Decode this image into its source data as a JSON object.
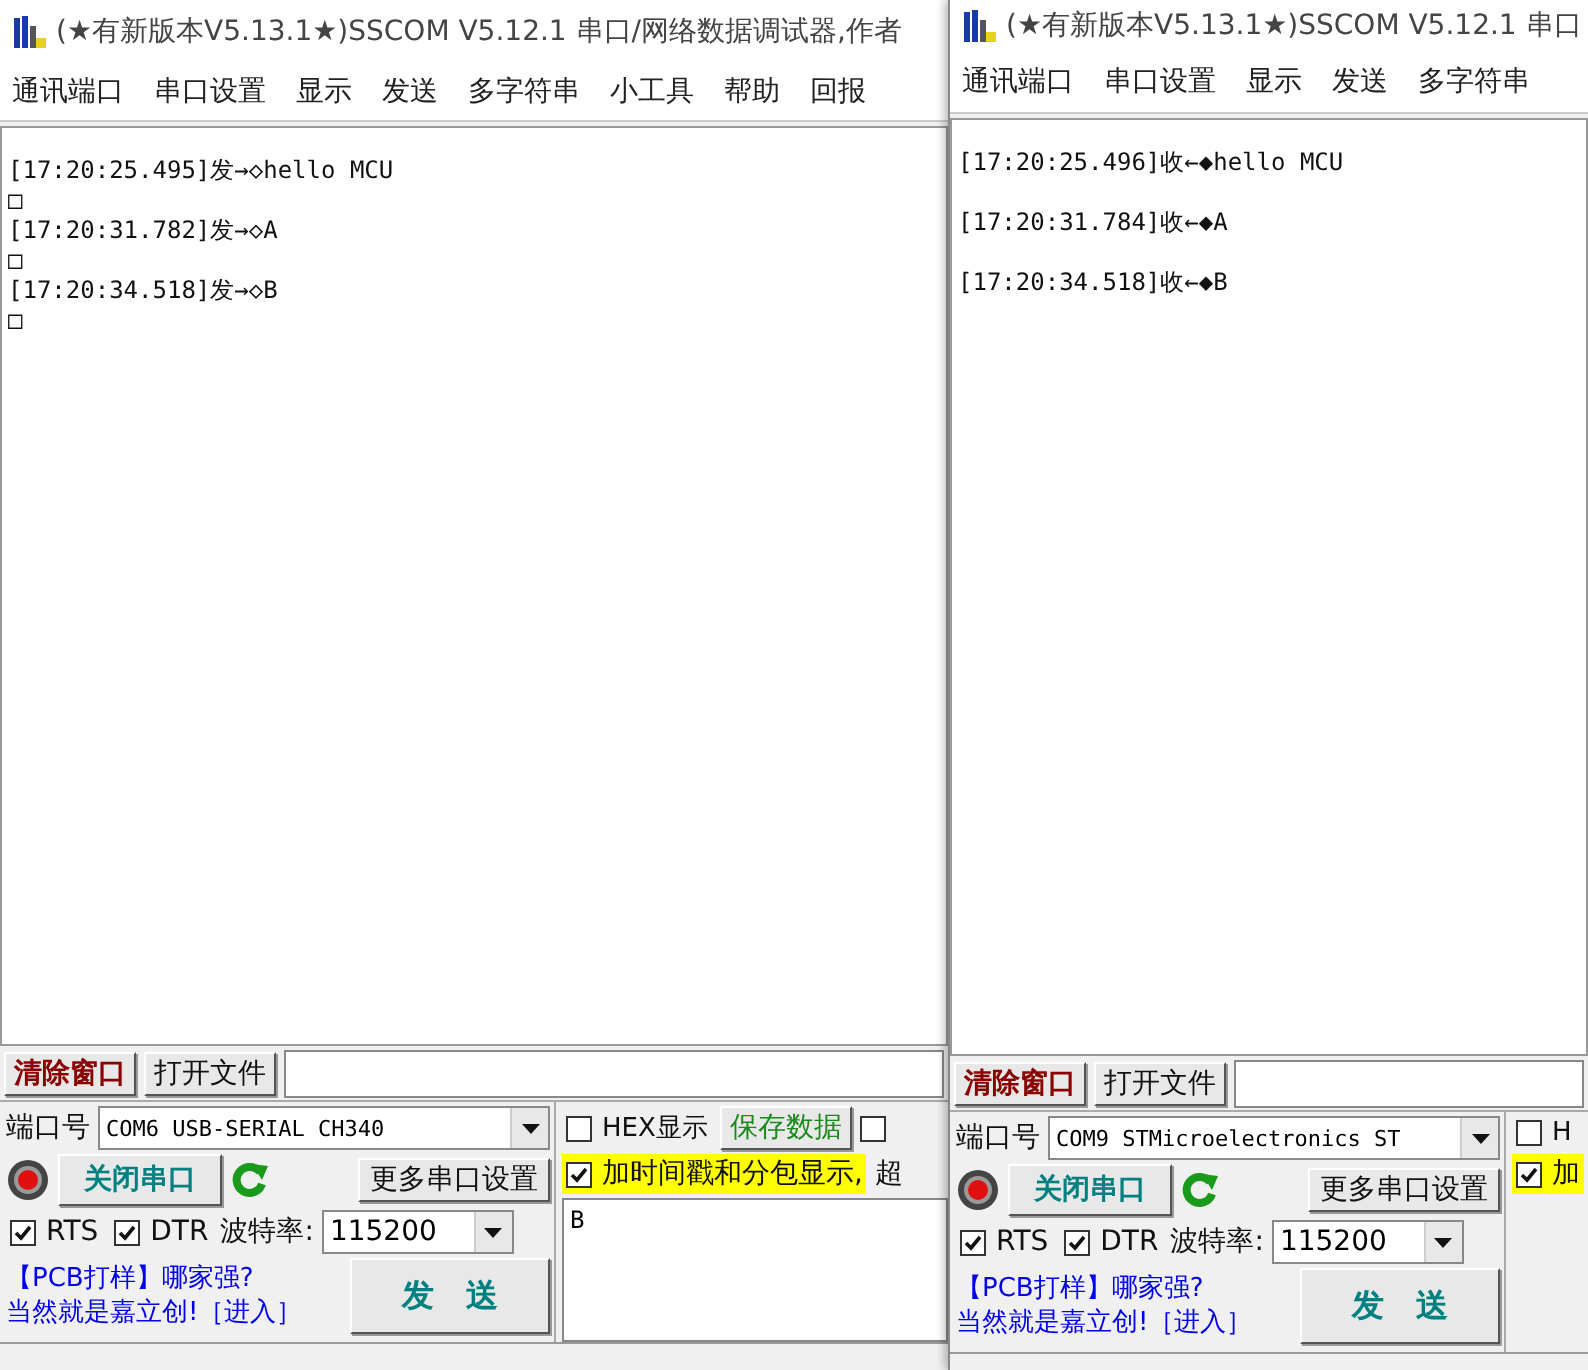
{
  "windows": [
    {
      "title": "(★有新版本V5.13.1★)SSCOM V5.12.1 串口/网络数据调试器,作者",
      "menu": [
        "通讯端口",
        "串口设置",
        "显示",
        "发送",
        "多字符串",
        "小工具",
        "帮助",
        "回报"
      ],
      "log": {
        "lines": [
          "[17:20:25.495]发→◇hello MCU",
          "□",
          "[17:20:31.782]发→◇A",
          "□",
          "[17:20:34.518]发→◇B",
          "□"
        ]
      },
      "clear_button": "清除窗口",
      "open_file_button": "打开文件",
      "port": {
        "label": "端口号",
        "value": "COM6 USB-SERIAL CH340"
      },
      "close_port_button": "关闭串口",
      "more_settings_button": "更多串口设置",
      "rts": {
        "label": "RTS",
        "checked": true
      },
      "dtr": {
        "label": "DTR",
        "checked": true
      },
      "baud": {
        "label": "波特率:",
        "value": "115200"
      },
      "promo": [
        "【PCB打样】哪家强?",
        "当然就是嘉立创!［进入］"
      ],
      "send_button": "发　送",
      "hex": {
        "label": "HEX显示",
        "checked": false
      },
      "save_button": "保存数据",
      "extra_checkbox": {
        "checked": false
      },
      "timestamp": {
        "label": "加时间戳和分包显示,",
        "checked": true
      },
      "timeout_label": "超",
      "send_text": "B"
    },
    {
      "title": "(★有新版本V5.13.1★)SSCOM V5.12.1 串口",
      "menu": [
        "通讯端口",
        "串口设置",
        "显示",
        "发送",
        "多字符串"
      ],
      "log": {
        "lines": [
          "[17:20:25.496]收←◆hello MCU",
          "[17:20:31.784]收←◆A",
          "[17:20:34.518]收←◆B"
        ]
      },
      "clear_button": "清除窗口",
      "open_file_button": "打开文件",
      "port": {
        "label": "端口号",
        "value": "COM9 STMicroelectronics ST"
      },
      "close_port_button": "关闭串口",
      "more_settings_button": "更多串口设置",
      "rts": {
        "label": "RTS",
        "checked": true
      },
      "dtr": {
        "label": "DTR",
        "checked": true
      },
      "baud": {
        "label": "波特率:",
        "value": "115200"
      },
      "promo": [
        "【PCB打样】哪家强?",
        "当然就是嘉立创!［进入］"
      ],
      "send_button": "发　送",
      "hex": {
        "label": "H",
        "checked": false
      },
      "timestamp": {
        "label": "加",
        "checked": true
      }
    }
  ]
}
